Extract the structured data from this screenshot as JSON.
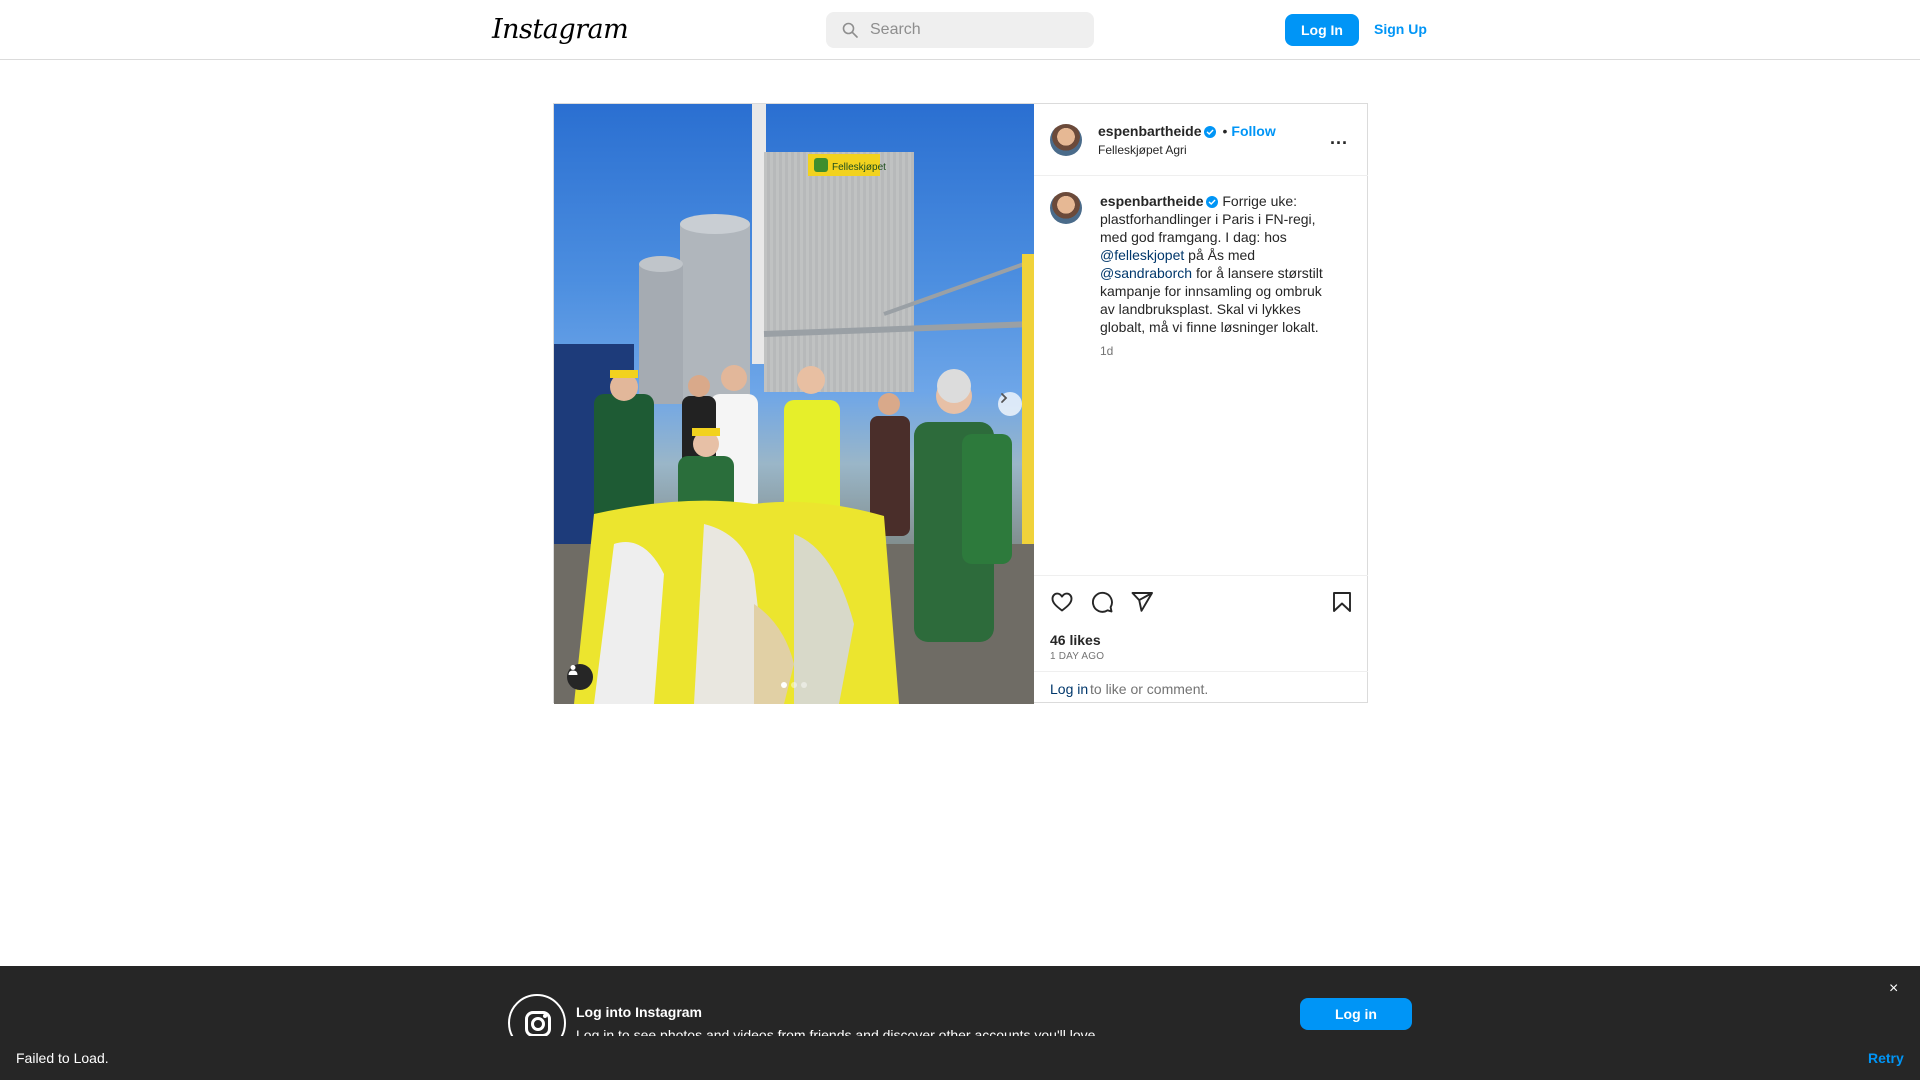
{
  "header": {
    "logo_text": "Instagram",
    "search_placeholder": "Search",
    "login_label": "Log In",
    "signup_label": "Sign Up"
  },
  "post": {
    "username": "espenbartheide",
    "separator": "•",
    "follow_label": "Follow",
    "location": "Felleskjøpet Agri",
    "more_label": "...",
    "media_sign_text": "Felleskjøpet",
    "caption": {
      "username": "espenbartheide",
      "text_1": "Forrige uke: plastforhandlinger i Paris i FN-regi, med god framgang. I dag: hos",
      "mention_1": "@felleskjopet",
      "text_2": "på Ås med",
      "mention_2": "@sandraborch",
      "text_3": "for å lansere størstilt kampanje for innsamling og ombruk av landbruksplast. Skal vi lykkes globalt, må vi finne løsninger lokalt.",
      "time": "1d"
    },
    "likes": "46 likes",
    "posted_ago": "1 DAY AGO",
    "comment_login": "Log in",
    "comment_rest": "to like or comment.",
    "carousel": {
      "count": 3,
      "active_index": 0
    }
  },
  "login_banner": {
    "title": "Log into Instagram",
    "subtitle": "Log in to see photos and videos from friends and discover other accounts you'll love.",
    "button_label": "Log in",
    "close_label": "×"
  },
  "snackbar": {
    "message": "Failed to Load.",
    "action_label": "Retry"
  },
  "colors": {
    "accent": "#0095f6",
    "border": "#dbdbdb",
    "banner_bg": "#262626",
    "verified": "#0095f6"
  },
  "icons": [
    "search-icon",
    "verified-badge-icon",
    "more-options-icon",
    "heart-icon",
    "comment-icon",
    "share-icon",
    "bookmark-icon",
    "chevron-right-icon",
    "tagged-user-icon",
    "instagram-logo-icon",
    "close-icon"
  ]
}
